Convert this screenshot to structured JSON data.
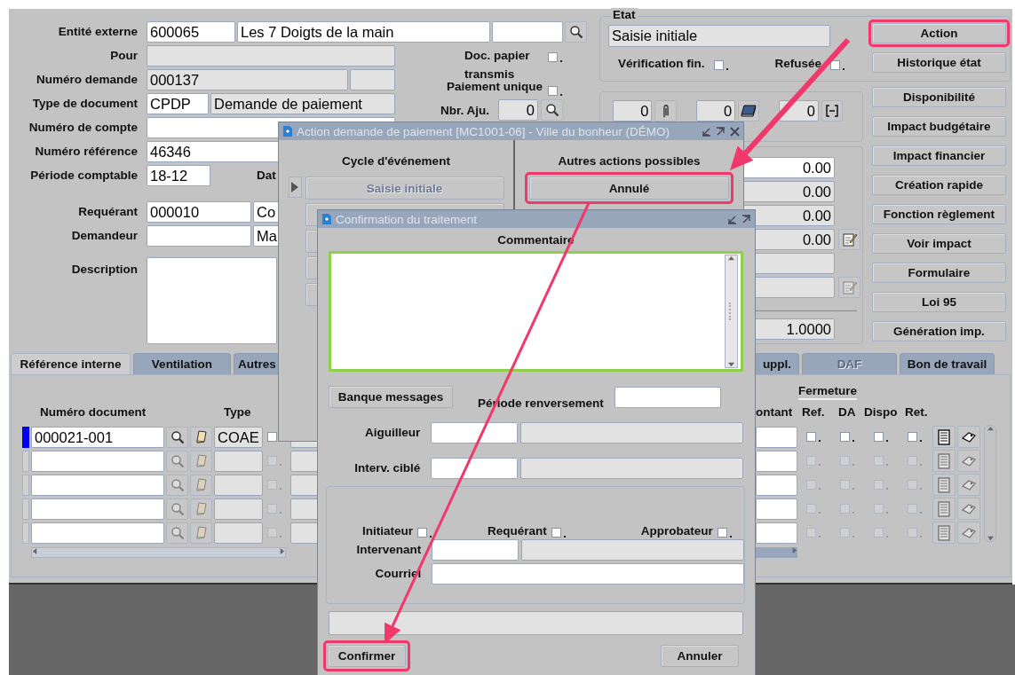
{
  "form_fields": [
    {
      "label": "Entité externe",
      "values": [
        "600065",
        "Les 7 Doigts de la main"
      ]
    },
    {
      "label": "Pour"
    },
    {
      "label": "Numéro demande",
      "values": [
        "000137"
      ]
    },
    {
      "label": "Type de document",
      "values": [
        "CPDP",
        "Demande de paiement"
      ]
    },
    {
      "label": "Numéro de compte"
    },
    {
      "label": "Numéro référence",
      "values": [
        "46346"
      ]
    },
    {
      "label": "Période comptable",
      "values": [
        "18-12"
      ],
      "side_label": "Dat"
    },
    {
      "label": "Requérant",
      "values": [
        "000010",
        "Co"
      ]
    },
    {
      "label": "Demandeur",
      "values": [
        "Ma"
      ]
    },
    {
      "label": "Description"
    }
  ],
  "options": {
    "doc_papier": {
      "label": "Doc. papier transmis",
      "checked": false
    },
    "paiement_unique": {
      "label": "Paiement unique",
      "checked": false
    },
    "nbr_aju": {
      "label": "Nbr. Aju.",
      "value": "0"
    }
  },
  "etat": {
    "legend": "Etat",
    "value": "Saisie initiale",
    "checks": [
      {
        "label": "Vérification fin.",
        "checked": false
      },
      {
        "label": "Refusée",
        "checked": false
      }
    ]
  },
  "counters": [
    "0",
    "0",
    "0"
  ],
  "amounts": [
    "0.00",
    "0.00",
    "0.00",
    "0.00"
  ],
  "rate": "1.0000",
  "action_buttons": [
    {
      "label": "Action",
      "highlighted": true
    },
    {
      "label": "Historique état",
      "highlighted": false
    },
    {
      "label": "Disponibilité",
      "highlighted": false
    },
    {
      "label": "Impact budgétaire",
      "highlighted": false
    },
    {
      "label": "Impact financier",
      "highlighted": false
    },
    {
      "label": "Création rapide",
      "highlighted": false
    },
    {
      "label": "Fonction règlement",
      "highlighted": false
    },
    {
      "label": "Voir impact",
      "highlighted": false
    },
    {
      "label": "Formulaire",
      "highlighted": false
    },
    {
      "label": "Loi 95",
      "highlighted": false
    },
    {
      "label": "Génération imp.",
      "highlighted": false
    }
  ],
  "tabs": [
    {
      "label": "Référence interne",
      "selected": true,
      "disabled": false
    },
    {
      "label": "Ventilation",
      "selected": false,
      "disabled": false
    },
    {
      "label": "Autres",
      "selected": false,
      "disabled": false
    },
    {
      "label": "uppl.",
      "selected": false,
      "disabled": false
    },
    {
      "label": "DAF",
      "selected": false,
      "disabled": true
    },
    {
      "label": "Bon de travail",
      "selected": false,
      "disabled": false
    }
  ],
  "table": {
    "columns_left": [
      "Numéro document",
      "Type"
    ],
    "group_header": "Fermeture",
    "columns_right": [
      "ontant",
      "Ref.",
      "DA",
      "Dispo",
      "Ret."
    ],
    "rows": [
      {
        "document": "000021-001",
        "type": "COAE",
        "current": true,
        "disabled": false,
        "checks": [
          false,
          false,
          false,
          false,
          false
        ]
      },
      {
        "current": false,
        "disabled": true,
        "checks": [
          false,
          false,
          false,
          false,
          false
        ]
      },
      {
        "current": false,
        "disabled": true,
        "checks": [
          false,
          false,
          false,
          false,
          false
        ]
      },
      {
        "current": false,
        "disabled": true,
        "checks": [
          false,
          false,
          false,
          false,
          false
        ]
      },
      {
        "current": false,
        "disabled": true,
        "checks": [
          false,
          false,
          false,
          false,
          false
        ]
      }
    ]
  },
  "action_dialog": {
    "title": "Action demande de paiement [MC1001-06] - Ville du bonheur (DÉMO)",
    "cycle_header": "Cycle d'événement",
    "cycle_steps": [
      {
        "label": "Saisie initiale",
        "current": true,
        "disabled": true
      }
    ],
    "other_header": "Autres actions possibles",
    "other_actions": [
      {
        "label": "Annulé",
        "highlighted": true
      }
    ]
  },
  "confirm_dialog": {
    "title": "Confirmation du traitement",
    "comment_label": "Commentaire",
    "message_bank_button": "Banque messages",
    "period_label": "Période renversement",
    "fields": [
      {
        "label": "Aiguilleur"
      },
      {
        "label": "Interv. ciblé"
      }
    ],
    "roles": [
      {
        "label": "Initiateur",
        "checked": false
      },
      {
        "label": "Requérant",
        "checked": false
      },
      {
        "label": "Approbateur",
        "checked": false
      }
    ],
    "intervenant_label": "Intervenant",
    "courriel_label": "Courriel",
    "buttons": [
      {
        "label": "Confirmer",
        "highlighted": true
      },
      {
        "label": "Annuler",
        "highlighted": false
      }
    ]
  }
}
